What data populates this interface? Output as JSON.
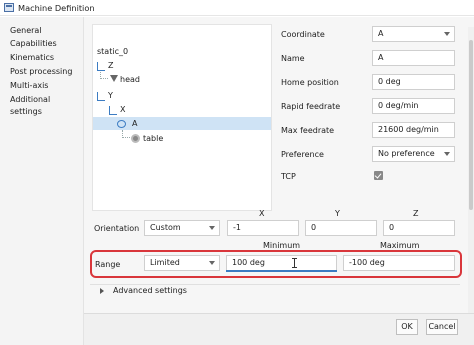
{
  "window": {
    "title": "Machine Definition"
  },
  "sidebar": {
    "items": [
      {
        "label": "General"
      },
      {
        "label": "Capabilities"
      },
      {
        "label": "Kinematics"
      },
      {
        "label": "Post processing"
      },
      {
        "label": "Multi-axis"
      },
      {
        "label": "Additional settings"
      }
    ]
  },
  "tree": {
    "nodes": [
      {
        "label": "static_0"
      },
      {
        "label": "Z"
      },
      {
        "label": "head"
      },
      {
        "label": "Y"
      },
      {
        "label": "X"
      },
      {
        "label": "A"
      },
      {
        "label": "table"
      }
    ]
  },
  "properties": {
    "coordinate": {
      "label": "Coordinate",
      "value": "A"
    },
    "name": {
      "label": "Name",
      "value": "A"
    },
    "home_position": {
      "label": "Home position",
      "value": "0 deg"
    },
    "rapid_feedrate": {
      "label": "Rapid feedrate",
      "value": "0 deg/min"
    },
    "max_feedrate": {
      "label": "Max feedrate",
      "value": "21600 deg/min"
    },
    "preference": {
      "label": "Preference",
      "value": "No preference"
    },
    "tcp": {
      "label": "TCP",
      "checked": true
    }
  },
  "orientation": {
    "label": "Orientation",
    "mode": "Custom",
    "headers": {
      "x": "X",
      "y": "Y",
      "z": "Z"
    },
    "x": "-1",
    "y": "0",
    "z": "0"
  },
  "range": {
    "label": "Range",
    "mode": "Limited",
    "min_header": "Minimum",
    "max_header": "Maximum",
    "minimum": "100 deg",
    "maximum": "-100 deg"
  },
  "advanced": {
    "label": "Advanced settings"
  },
  "buttons": {
    "ok": "OK",
    "cancel": "Cancel"
  },
  "colors": {
    "highlight": "#d9363b",
    "selection": "#cfe3f5",
    "accent": "#3c7cc2"
  }
}
